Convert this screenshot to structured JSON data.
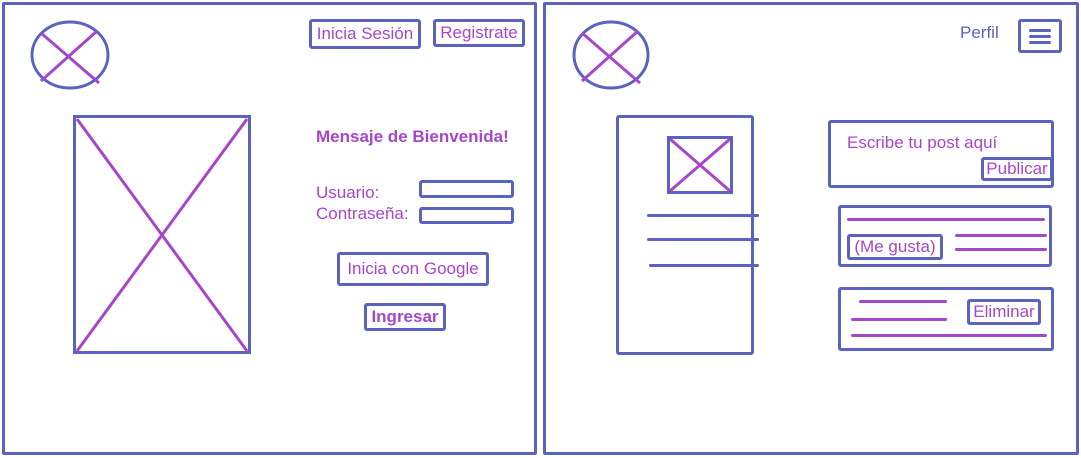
{
  "colors": {
    "stroke": "#5b62bf",
    "accent": "#a646c9"
  },
  "login_screen": {
    "logo_icon": "placeholder-image-icon",
    "login_button": "Inicia Sesión",
    "register_button": "Registrate",
    "welcome_message": "Mensaje de Bienvenida!",
    "username_label": "Usuario:",
    "password_label": "Contraseña:",
    "google_button": "Inicia con Google",
    "submit_button": "Ingresar"
  },
  "feed_screen": {
    "logo_icon": "placeholder-image-icon",
    "profile_link": "Perfil",
    "menu_icon": "hamburger-menu-icon",
    "post_placeholder": "Escribe tu post aquí",
    "publish_button": "Publicar",
    "like_button": "(Me gusta)",
    "delete_button": "Eliminar"
  }
}
